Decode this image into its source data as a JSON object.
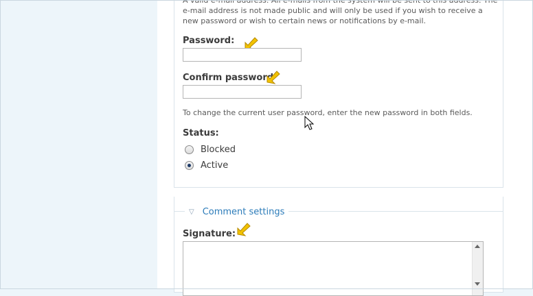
{
  "account": {
    "email_description": "A valid e-mail address. All e-mails from the system will be sent to this address. The e-mail address is not made public and will only be used if you wish to receive a new password or wish to certain news or notifications by e-mail.",
    "password_label": "Password:",
    "password_value": "",
    "confirm_label": "Confirm password",
    "confirm_value": "",
    "password_help": "To change the current user password, enter the new password in both fields.",
    "status_label": "Status:",
    "status_options": [
      {
        "label": "Blocked",
        "checked": false
      },
      {
        "label": "Active",
        "checked": true
      }
    ]
  },
  "comment_settings": {
    "legend": "Comment settings",
    "collapse_icon": "triangle-down-icon",
    "signature_label": "Signature:",
    "signature_value": ""
  },
  "icons": {
    "annotation_arrow": "arrow-pointer-icon",
    "mouse_cursor": "mouse-cursor-icon"
  },
  "colors": {
    "page_background": "#edf5fa",
    "link_blue": "#2b7bb9",
    "fieldset_border": "#d9e3ea",
    "annotation_arrow": "#f2c200"
  }
}
